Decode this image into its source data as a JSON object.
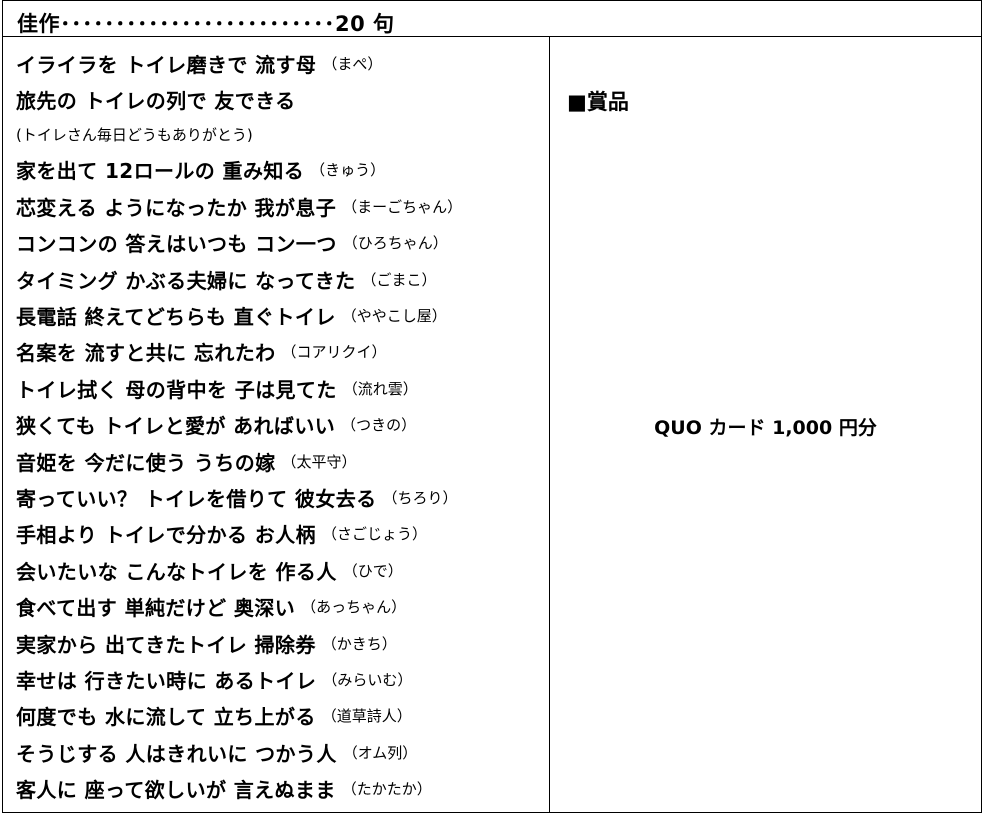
{
  "header": {
    "title": "佳作･････････････････････････20 句"
  },
  "entries": [
    {
      "poem": "イライラを トイレ磨きで 流す母",
      "author": "（まぺ）"
    },
    {
      "poem": "旅先の トイレの列で 友できる",
      "author": ""
    },
    {
      "note": "(トイレさん毎日どうもありがとう)"
    },
    {
      "poem": "家を出て 12ロールの 重み知る",
      "author": "（きゅう）"
    },
    {
      "poem": "芯変える ようになったか 我が息子",
      "author": "（まーごちゃん）"
    },
    {
      "poem": "コンコンの 答えはいつも コン一つ",
      "author": "（ひろちゃん）"
    },
    {
      "poem": "タイミング かぶる夫婦に なってきた",
      "author": "（ごまこ）"
    },
    {
      "poem": "長電話 終えてどちらも 直ぐトイレ",
      "author": "（ややこし屋）"
    },
    {
      "poem": "名案を 流すと共に 忘れたわ",
      "author": "（コアリクイ）"
    },
    {
      "poem": "トイレ拭く 母の背中を 子は見てた",
      "author": "（流れ雲）"
    },
    {
      "poem": "狭くても トイレと愛が あればいい",
      "author": "（つきの）"
    },
    {
      "poem": "音姫を 今だに使う うちの嫁",
      "author": "（太平守）"
    },
    {
      "poem": "寄っていい？ トイレを借りて 彼女去る",
      "author": "（ちろり）"
    },
    {
      "poem": "手相より トイレで分かる お人柄",
      "author": "（さごじょう）"
    },
    {
      "poem": "会いたいな こんなトイレを 作る人",
      "author": "（ひで）"
    },
    {
      "poem": "食べて出す 単純だけど 奥深い",
      "author": "（あっちゃん）"
    },
    {
      "poem": "実家から 出てきたトイレ 掃除券",
      "author": "（かきち）"
    },
    {
      "poem": "幸せは 行きたい時に あるトイレ",
      "author": "（みらいむ）"
    },
    {
      "poem": "何度でも 水に流して 立ち上がる",
      "author": "（道草詩人）"
    },
    {
      "poem": "そうじする 人はきれいに つかう人",
      "author": "（オム列）"
    },
    {
      "poem": "客人に 座って欲しいが 言えぬまま",
      "author": "（たかたか）"
    }
  ],
  "prize": {
    "heading": "■賞品",
    "value": "QUO カード 1,000 円分"
  }
}
